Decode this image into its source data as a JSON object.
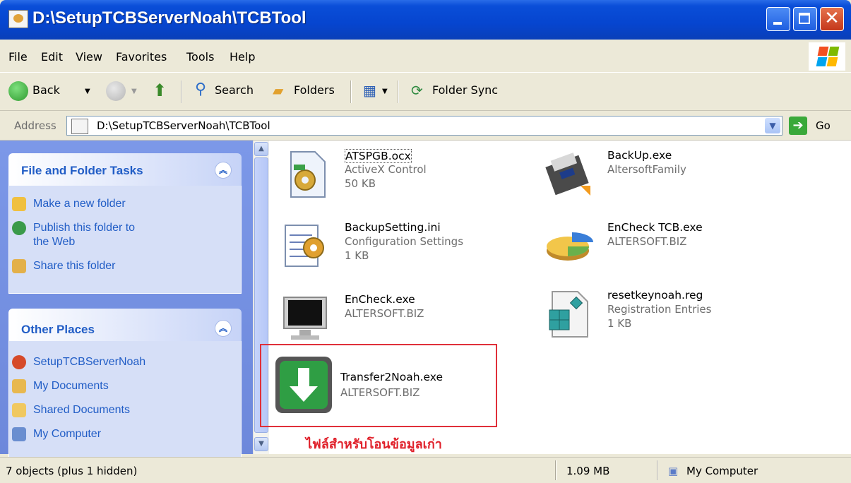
{
  "window": {
    "title": "D:\\SetupTCBServerNoah\\TCBTool"
  },
  "menu": [
    "File",
    "Edit",
    "View",
    "Favorites",
    "Tools",
    "Help"
  ],
  "toolbar": {
    "back": "Back",
    "search": "Search",
    "folders": "Folders",
    "folder_sync": "Folder Sync"
  },
  "address": {
    "label": "Address",
    "value": "D:\\SetupTCBServerNoah\\TCBTool",
    "go": "Go"
  },
  "left_panel": {
    "tasks_title": "File and Folder Tasks",
    "tasks": [
      "Make a new folder",
      "Publish this folder to",
      "the Web",
      "Share this folder"
    ],
    "places_title": "Other Places",
    "places": [
      "SetupTCBServerNoah",
      "My Documents",
      "Shared Documents",
      "My Computer"
    ]
  },
  "files": [
    {
      "name": "ATSPGB.ocx",
      "desc": "ActiveX Control",
      "size": "50 KB",
      "icon": "ocx-gear-icon"
    },
    {
      "name": "BackUp.exe",
      "desc": "AltersoftFamily",
      "size": "",
      "icon": "backup-icon"
    },
    {
      "name": "BackupSetting.ini",
      "desc": "Configuration Settings",
      "size": "1 KB",
      "icon": "ini-gear-icon"
    },
    {
      "name": "EnCheck TCB.exe",
      "desc": "ALTERSOFT.BIZ",
      "size": "",
      "icon": "pie-chart-icon"
    },
    {
      "name": "EnCheck.exe",
      "desc": "ALTERSOFT.BIZ",
      "size": "",
      "icon": "monitor-icon"
    },
    {
      "name": "resetkeynoah.reg",
      "desc": "Registration Entries",
      "size": "1 KB",
      "icon": "registry-icon"
    },
    {
      "name": "Transfer2Noah.exe",
      "desc": "ALTERSOFT.BIZ",
      "size": "",
      "icon": "download-arrow-icon"
    }
  ],
  "annotation": "ไฟล์สำหรับโอนข้อมูลเก่า",
  "status": {
    "objects": "7 objects (plus 1 hidden)",
    "size": "1.09 MB",
    "location": "My Computer"
  }
}
